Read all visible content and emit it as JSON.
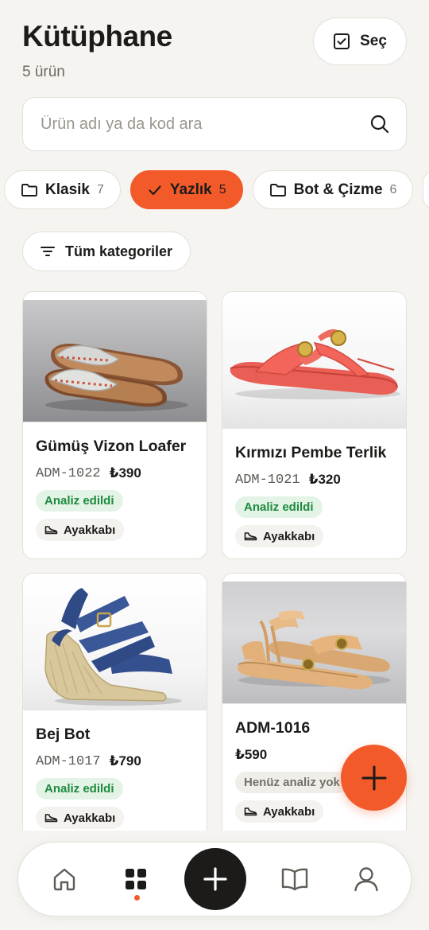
{
  "header": {
    "title": "Kütüphane",
    "subtitle": "5 ürün",
    "select_label": "Seç"
  },
  "search": {
    "placeholder": "Ürün adı ya da kod ara",
    "value": ""
  },
  "chips": [
    {
      "label": "Klasik",
      "count": "7",
      "icon": "folder-icon",
      "active": false
    },
    {
      "label": "Yazlık",
      "count": "5",
      "icon": "check-icon",
      "active": true
    },
    {
      "label": "Bot & Çizme",
      "count": "6",
      "icon": "folder-icon",
      "active": false
    }
  ],
  "filter": {
    "label": "Tüm kategoriler"
  },
  "products": [
    {
      "name": "Gümüş Vizon Loafer",
      "code": "ADM-1022",
      "price": "₺390",
      "status": "Analiz edildi",
      "status_kind": "analyzed",
      "category": "Ayakkabı"
    },
    {
      "name": "Kırmızı Pembe Terlik",
      "code": "ADM-1021",
      "price": "₺320",
      "status": "Analiz edildi",
      "status_kind": "analyzed",
      "category": "Ayakkabı"
    },
    {
      "name": "Bej Bot",
      "code": "ADM-1017",
      "price": "₺790",
      "status": "Analiz edildi",
      "status_kind": "analyzed",
      "category": "Ayakkabı"
    },
    {
      "name": "ADM-1016",
      "code": "",
      "price": "₺590",
      "status": "Henüz analiz yok",
      "status_kind": "pending",
      "category": "Ayakkabı"
    }
  ],
  "colors": {
    "accent": "#f25a2a",
    "background": "#f5f4f0",
    "analyzed_bg": "#e3f3e6",
    "analyzed_text": "#1e8a3e",
    "dark": "#1c1b19"
  },
  "nav": {
    "active": "grid-icon",
    "items": [
      "home-icon",
      "grid-icon",
      "add-icon",
      "book-icon",
      "profile-icon"
    ]
  }
}
